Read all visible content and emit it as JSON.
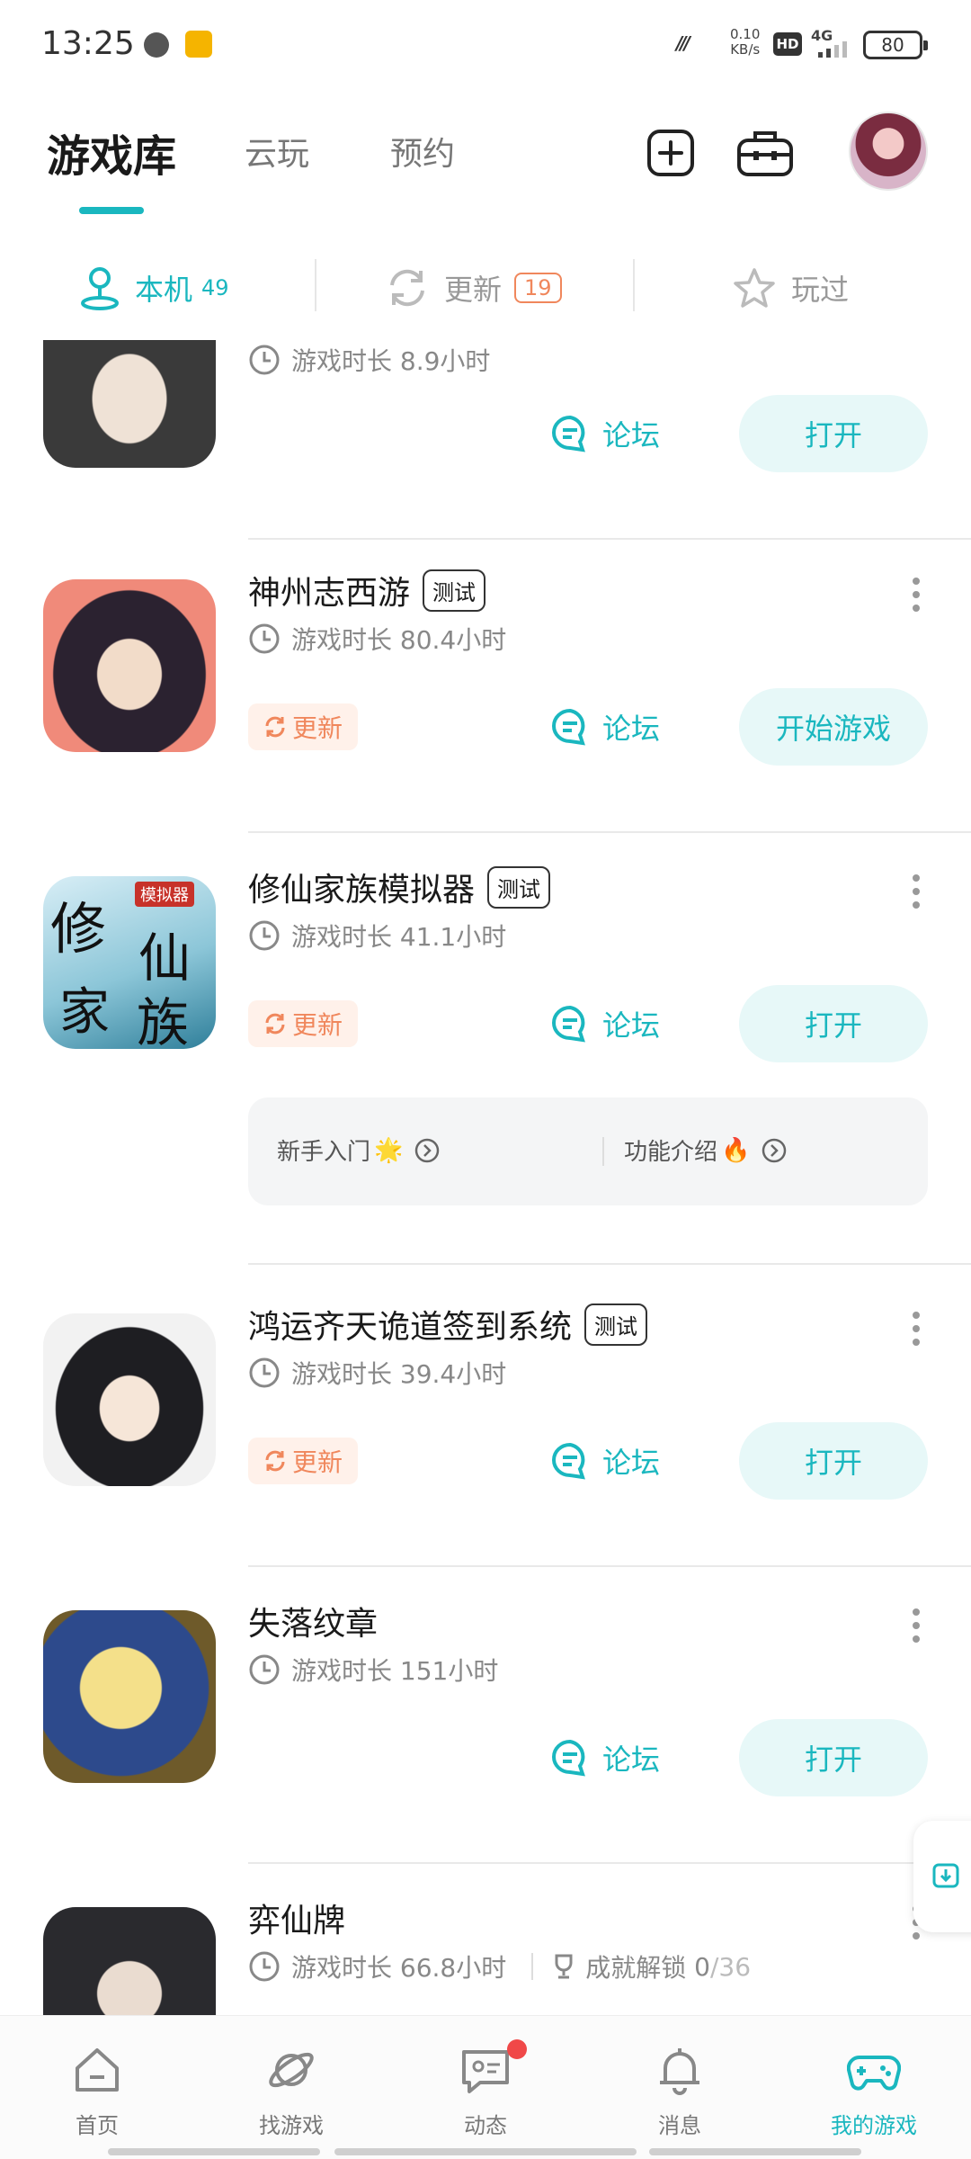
{
  "status_bar": {
    "time": "13:25",
    "net_speed_value": "0.10",
    "net_speed_unit": "KB/s",
    "hd": "HD",
    "network": "4G",
    "battery": "80"
  },
  "header": {
    "tabs": [
      {
        "label": "游戏库",
        "active": true
      },
      {
        "label": "云玩",
        "active": false
      },
      {
        "label": "预约",
        "active": false
      }
    ]
  },
  "subtabs": {
    "local": {
      "label": "本机",
      "count": "49"
    },
    "update": {
      "label": "更新",
      "count": "19"
    },
    "played": {
      "label": "玩过"
    }
  },
  "labels": {
    "forum": "论坛",
    "open": "打开",
    "start": "开始游戏",
    "update": "更新",
    "test": "测试",
    "achievement": "成就解锁"
  },
  "games": [
    {
      "title": "",
      "play_time": "游戏时长 8.9小时",
      "action": "打开"
    },
    {
      "title": "神州志西游",
      "tag": "测试",
      "play_time": "游戏时长 80.4小时",
      "action": "开始游戏",
      "has_update": true
    },
    {
      "title": "修仙家族模拟器",
      "tag": "测试",
      "play_time": "游戏时长 41.1小时",
      "action": "打开",
      "has_update": true,
      "cover_text": {
        "banner": "模拟器",
        "chars": [
          "修",
          "仙",
          "家",
          "族"
        ]
      },
      "guide": {
        "left": "新手入门",
        "left_emoji": "🌟",
        "right": "功能介绍",
        "right_emoji": "🔥"
      }
    },
    {
      "title": "鸿运齐天诡道签到系统",
      "tag": "测试",
      "play_time": "游戏时长 39.4小时",
      "action": "打开",
      "has_update": true
    },
    {
      "title": "失落纹章",
      "play_time": "游戏时长 151小时",
      "action": "打开"
    },
    {
      "title": "弈仙牌",
      "play_time": "游戏时长 66.8小时",
      "achievement": {
        "unlocked": "0",
        "total": "/36"
      }
    }
  ],
  "bottom_nav": [
    {
      "label": "首页",
      "icon": "home-icon",
      "active": false
    },
    {
      "label": "找游戏",
      "icon": "planet-icon",
      "active": false
    },
    {
      "label": "动态",
      "icon": "chat-icon",
      "active": false,
      "has_dot": true
    },
    {
      "label": "消息",
      "icon": "bell-icon",
      "active": false
    },
    {
      "label": "我的游戏",
      "icon": "gamepad-icon",
      "active": true
    }
  ],
  "colors": {
    "accent": "#1ab7bf",
    "update": "#f0875c",
    "button_bg": "#e7f8f8",
    "notification_dot": "#f04848"
  }
}
